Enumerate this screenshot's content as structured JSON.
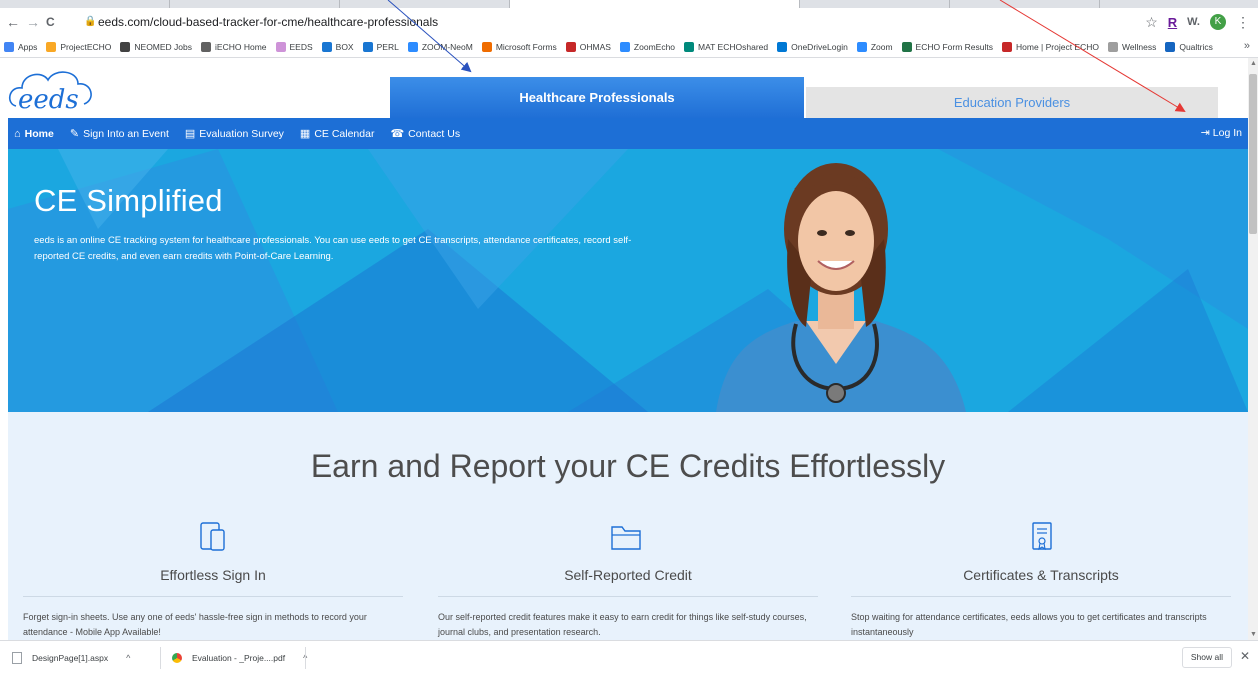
{
  "browser": {
    "url": "eeds.com/cloud-based-tracker-for-cme/healthcare-professionals",
    "nav": {
      "back": "←",
      "forward": "→",
      "reload": "C"
    },
    "ext_r": "R",
    "ext_w": "W.",
    "avatar_initial": "K",
    "bookmarks": [
      {
        "label": "Apps",
        "color": "#4285f4",
        "icon": "apps-grid-icon"
      },
      {
        "label": "ProjectECHO",
        "color": "#f9a825",
        "icon": "echo-icon"
      },
      {
        "label": "NEOMED Jobs",
        "color": "#424242",
        "icon": "neomed-icon"
      },
      {
        "label": "iECHO Home",
        "color": "#616161",
        "icon": "iecho-icon"
      },
      {
        "label": "EEDS",
        "color": "#ce93d8",
        "icon": "eeds-icon"
      },
      {
        "label": "BOX",
        "color": "#1976d2",
        "icon": "box-icon"
      },
      {
        "label": "PERL",
        "color": "#1976d2",
        "icon": "box-icon"
      },
      {
        "label": "ZOOM-NeoM",
        "color": "#2d8cff",
        "icon": "zoom-icon"
      },
      {
        "label": "Microsoft Forms",
        "color": "#ef6c00",
        "icon": "ms-icon"
      },
      {
        "label": "OHMAS",
        "color": "#c62828",
        "icon": "ohmas-icon"
      },
      {
        "label": "ZoomEcho",
        "color": "#2d8cff",
        "icon": "zoom-icon"
      },
      {
        "label": "MAT ECHOshared",
        "color": "#00897b",
        "icon": "sharepoint-icon"
      },
      {
        "label": "OneDriveLogin",
        "color": "#0078d4",
        "icon": "cloud-icon"
      },
      {
        "label": "Zoom",
        "color": "#2d8cff",
        "icon": "zoom-icon"
      },
      {
        "label": "ECHO Form Results",
        "color": "#217346",
        "icon": "excel-icon"
      },
      {
        "label": "Home | Project ECHO",
        "color": "#c62828",
        "icon": "echo-home-icon"
      },
      {
        "label": "Wellness",
        "color": "#9e9e9e",
        "icon": "wellness-icon"
      },
      {
        "label": "Qualtrics",
        "color": "#1565c0",
        "icon": "qualtrics-icon"
      }
    ],
    "bookmarks_more": "»"
  },
  "site": {
    "tabs": {
      "active": "Healthcare Professionals",
      "inactive": "Education Providers"
    },
    "nav": [
      {
        "label": "Home",
        "icon": "home-icon"
      },
      {
        "label": "Sign Into an Event",
        "icon": "sign-in-edit-icon"
      },
      {
        "label": "Evaluation Survey",
        "icon": "survey-icon"
      },
      {
        "label": "CE Calendar",
        "icon": "calendar-icon"
      },
      {
        "label": "Contact Us",
        "icon": "phone-icon"
      }
    ],
    "login": "Log In",
    "hero": {
      "title": "CE Simplified",
      "description": "eeds is an online CE tracking system for healthcare professionals. You can use eeds to get CE transcripts, attendance certificates, record self-reported CE credits, and even earn credits with Point-of-Care Learning."
    },
    "section_heading": "Earn and Report your CE Credits Effortlessly",
    "features": [
      {
        "title": "Effortless Sign In",
        "icon": "devices-icon",
        "desc": "Forget sign-in sheets. Use any one of eeds' hassle-free sign in methods to record your attendance - Mobile App Available!"
      },
      {
        "title": "Self-Reported Credit",
        "icon": "folder-icon",
        "desc": "Our self-reported credit features make it easy to earn credit for things like self-study courses, journal clubs, and presentation research."
      },
      {
        "title": "Certificates & Transcripts",
        "icon": "certificate-icon",
        "desc": "Stop waiting for attendance certificates, eeds allows you to get certificates and transcripts instantaneously"
      }
    ]
  },
  "downloads": {
    "items": [
      {
        "name": "DesignPage[1].aspx",
        "icon": "file-icon"
      },
      {
        "name": "Evaluation - _Proje....pdf",
        "icon": "chrome-icon"
      }
    ],
    "show_all": "Show all",
    "close": "✕"
  },
  "colors": {
    "brand_blue": "#1d6fd6",
    "hero_blue": "#1ba7e0",
    "annotation_blue": "#2a52be",
    "annotation_red": "#e53935"
  }
}
